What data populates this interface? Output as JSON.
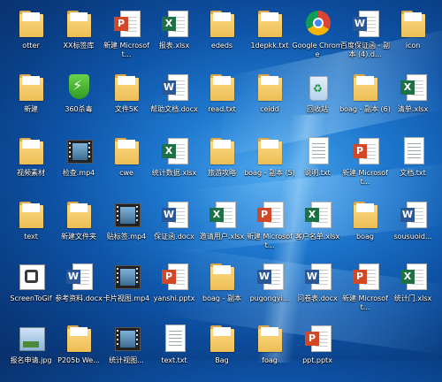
{
  "desktop": {
    "icons": [
      {
        "label": "otter",
        "type": "folder"
      },
      {
        "label": "XX标签库",
        "type": "folder"
      },
      {
        "label": "新建 Microsoft...",
        "type": "ppt"
      },
      {
        "label": "报表.xlsx",
        "type": "excel"
      },
      {
        "label": "ededs",
        "type": "folder"
      },
      {
        "label": "1depkk.txt",
        "type": "folder"
      },
      {
        "label": "Google Chrome",
        "type": "chrome"
      },
      {
        "label": "百度保证函 - 副本 (4).d...",
        "type": "word"
      },
      {
        "label": "icon",
        "type": "folder"
      },
      {
        "label": "新建",
        "type": "folder"
      },
      {
        "label": "360杀毒",
        "type": "shield"
      },
      {
        "label": "文件5K",
        "type": "folder"
      },
      {
        "label": "帮助文档.docx",
        "type": "word"
      },
      {
        "label": "read.txt",
        "type": "folder"
      },
      {
        "label": "ceidd",
        "type": "folder"
      },
      {
        "label": "回收站",
        "type": "recycle"
      },
      {
        "label": "boag - 副本 (6)",
        "type": "folder"
      },
      {
        "label": "清单.xlsx",
        "type": "excel"
      },
      {
        "label": "视频素材",
        "type": "folder"
      },
      {
        "label": "检查.mp4",
        "type": "video"
      },
      {
        "label": "cwe",
        "type": "folder"
      },
      {
        "label": "统计数据.xlsx",
        "type": "excel"
      },
      {
        "label": "旅游攻略",
        "type": "folder"
      },
      {
        "label": "boag - 副本 (5)",
        "type": "folder"
      },
      {
        "label": "说明.txt",
        "type": "txt"
      },
      {
        "label": "新建 Microsoft...",
        "type": "ppt"
      },
      {
        "label": "文档.txt",
        "type": "txt"
      },
      {
        "label": "text",
        "type": "folder"
      },
      {
        "label": "新建文件夹",
        "type": "folder"
      },
      {
        "label": "贴标签.mp4",
        "type": "video"
      },
      {
        "label": "保证函.docx",
        "type": "word"
      },
      {
        "label": "邀请用户.xlsx",
        "type": "excel"
      },
      {
        "label": "新建 Microsoft...",
        "type": "ppt"
      },
      {
        "label": "客户名单.xlsx",
        "type": "excel"
      },
      {
        "label": "boag",
        "type": "folder"
      },
      {
        "label": "sousuoid...",
        "type": "word"
      },
      {
        "label": "ScreenToGif",
        "type": "gif"
      },
      {
        "label": "参考资料.docx",
        "type": "word"
      },
      {
        "label": "卡片视图.mp4",
        "type": "video"
      },
      {
        "label": "yanshi.pptx",
        "type": "ppt"
      },
      {
        "label": "boag - 副本",
        "type": "folder"
      },
      {
        "label": "pugongyi...",
        "type": "word"
      },
      {
        "label": "问卷表.docx",
        "type": "word"
      },
      {
        "label": "新建 Microsoft...",
        "type": "ppt"
      },
      {
        "label": "统计门.xlsx",
        "type": "excel"
      },
      {
        "label": "报名申请.jpg",
        "type": "img"
      },
      {
        "label": "P205b We...",
        "type": "folder"
      },
      {
        "label": "统计视图...",
        "type": "video"
      },
      {
        "label": "text.txt",
        "type": "txt"
      },
      {
        "label": "Bag",
        "type": "folder"
      },
      {
        "label": "foag",
        "type": "folder"
      },
      {
        "label": "ppt.pptx",
        "type": "ppt"
      }
    ]
  }
}
